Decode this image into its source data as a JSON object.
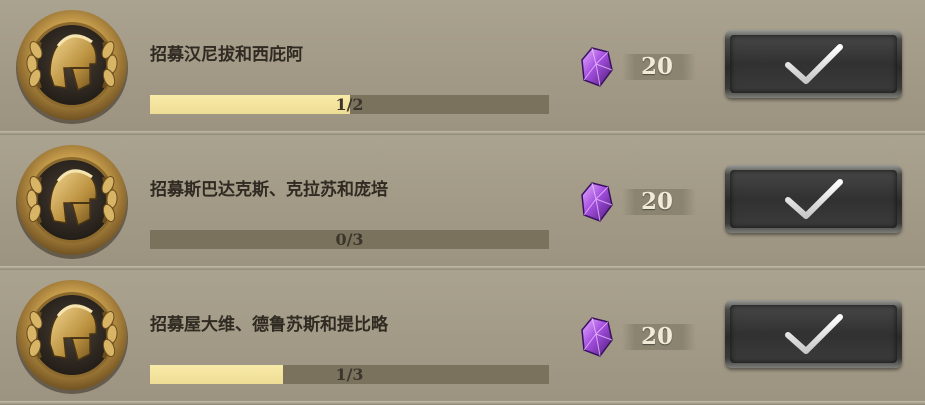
{
  "quests": [
    {
      "title": "招募汉尼拔和西庇阿",
      "progress_text": "1/2",
      "progress": 0.5,
      "reward_count": "20"
    },
    {
      "title": "招募斯巴达克斯、克拉苏和庞培",
      "progress_text": "0/3",
      "progress": 0.0,
      "reward_count": "20"
    },
    {
      "title": "招募屋大维、德鲁苏斯和提比略",
      "progress_text": "1/3",
      "progress": 0.333,
      "reward_count": "20"
    }
  ],
  "icons": {
    "medal": "helmet-laurel-medal-icon",
    "reward": "purple-gem-icon",
    "claim": "checkmark-icon"
  },
  "colors": {
    "progress_fill": "#f2e29e",
    "progress_track": "#7a725d",
    "gem": "#a53fd6",
    "medal_gold": "#c9a24a"
  }
}
